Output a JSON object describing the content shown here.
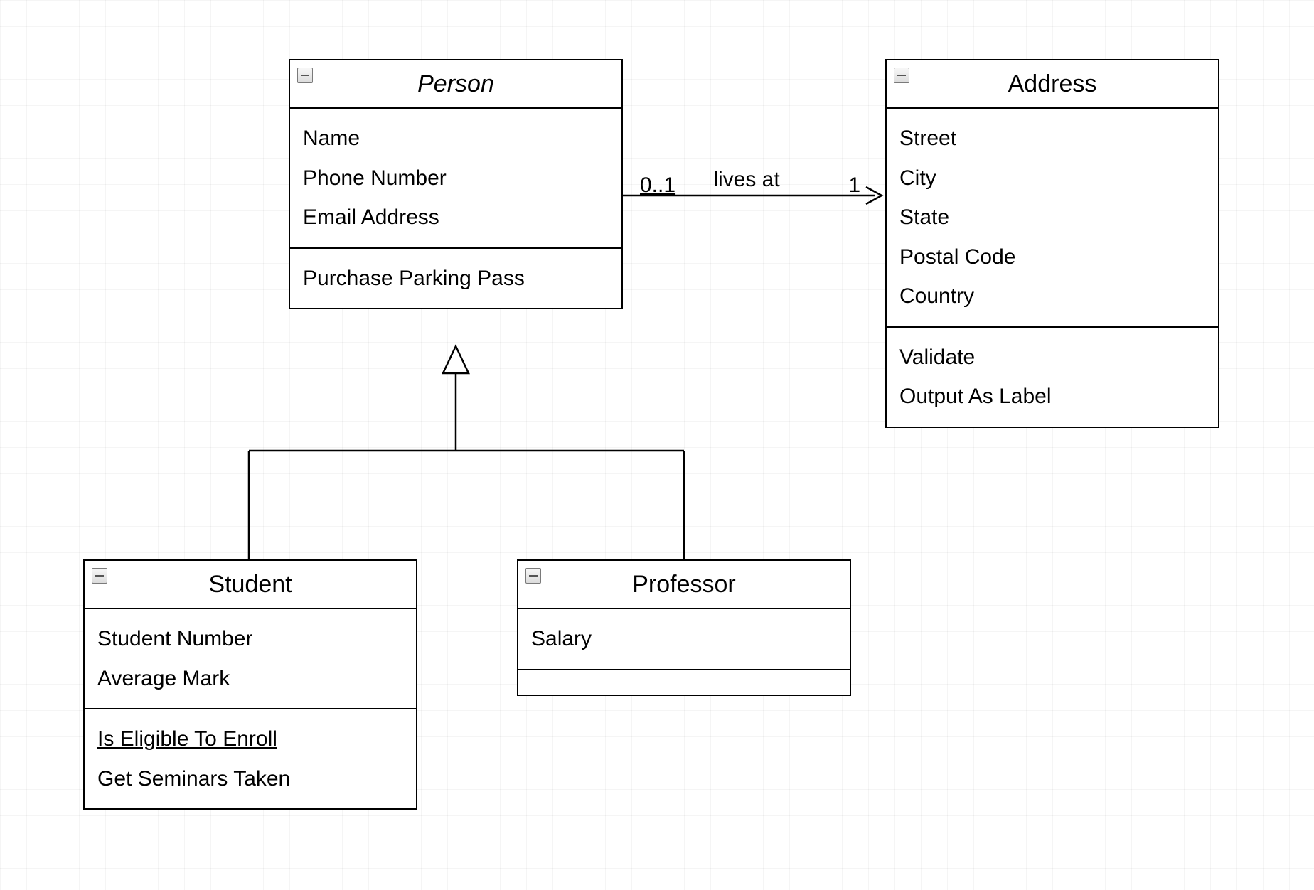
{
  "classes": {
    "person": {
      "title": "Person",
      "abstract": true,
      "attributes": [
        "Name",
        "Phone Number",
        "Email Address"
      ],
      "operations": [
        "Purchase Parking Pass"
      ]
    },
    "address": {
      "title": "Address",
      "abstract": false,
      "attributes": [
        "Street",
        "City",
        "State",
        "Postal Code",
        "Country"
      ],
      "operations": [
        "Validate",
        "Output As Label"
      ]
    },
    "student": {
      "title": "Student",
      "abstract": false,
      "attributes": [
        "Student Number",
        "Average Mark"
      ],
      "operations": [
        {
          "text": "Is Eligible To Enroll",
          "underline": true
        },
        {
          "text": "Get Seminars Taken",
          "underline": false
        }
      ]
    },
    "professor": {
      "title": "Professor",
      "abstract": false,
      "attributes": [
        "Salary"
      ],
      "operations": []
    }
  },
  "association": {
    "label": "lives at",
    "source_multiplicity": "0..1",
    "target_multiplicity": "1"
  }
}
